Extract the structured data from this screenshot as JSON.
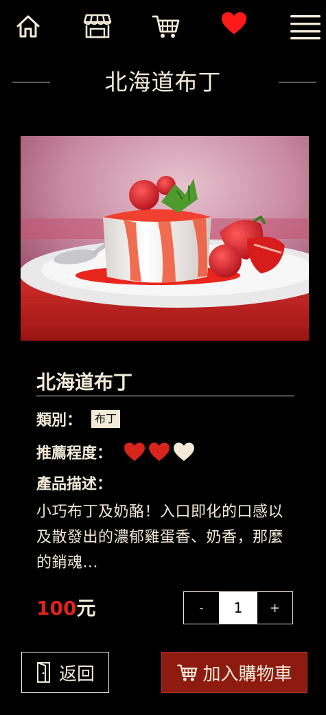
{
  "nav": {
    "icons": [
      "home-icon",
      "store-icon",
      "cart-icon",
      "heart-icon",
      "menu-icon"
    ],
    "accent_heart_color": "#ff1a1a"
  },
  "page": {
    "title": "北海道布丁"
  },
  "product": {
    "name": "北海道布丁",
    "category_label": "類別：",
    "category": "布丁",
    "rating_label": "推薦程度：",
    "rating": 2,
    "rating_max": 3,
    "description_label": "產品描述：",
    "description": "小巧布丁及奶酪！入口即化的口感以及散發出的濃郁雞蛋香、奶香，那麼的銷魂...",
    "price_value": "100",
    "price_unit": "元"
  },
  "quantity": {
    "minus_label": "-",
    "value": "1",
    "plus_label": "+"
  },
  "actions": {
    "back_label": "返回",
    "add_to_cart_label": "加入購物車"
  },
  "colors": {
    "text": "#f3ead9",
    "price": "#e3231a",
    "heart_filled": "#d8251b",
    "heart_empty": "#f3ead9",
    "cart_button": "#8e1b10"
  }
}
